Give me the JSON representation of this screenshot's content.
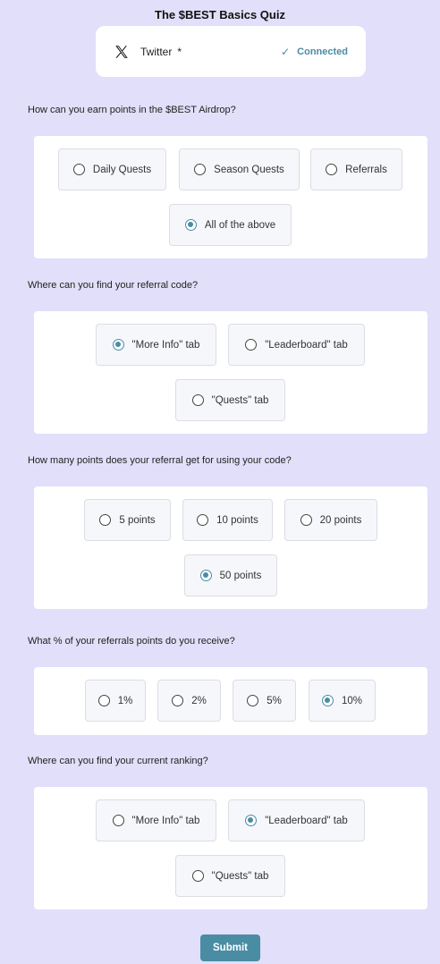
{
  "title": "The $BEST Basics Quiz",
  "twitter": {
    "label": "Twitter",
    "required_mark": "*",
    "status": "Connected",
    "status_icon": "checkmark-icon",
    "logo_icon": "x-logo-icon"
  },
  "accent_color": "#4a8ca3",
  "questions": [
    {
      "text": "How can you earn points in the $BEST Airdrop?",
      "options": [
        "Daily Quests",
        "Season Quests",
        "Referrals",
        "All of the above"
      ],
      "selected": "All of the above"
    },
    {
      "text": "Where can you find your referral code?",
      "options": [
        "\"More Info\" tab",
        "\"Leaderboard\" tab",
        "\"Quests\" tab"
      ],
      "selected": "\"More Info\" tab"
    },
    {
      "text": "How many points does your referral get for using your code?",
      "options": [
        "5 points",
        "10 points",
        "20 points",
        "50 points"
      ],
      "selected": "50 points"
    },
    {
      "text": "What % of your referrals points do you receive?",
      "options": [
        "1%",
        "2%",
        "5%",
        "10%"
      ],
      "selected": "10%"
    },
    {
      "text": "Where can you find your current ranking?",
      "options": [
        "\"More Info\" tab",
        "\"Leaderboard\" tab",
        "\"Quests\" tab"
      ],
      "selected": "\"Leaderboard\" tab"
    }
  ],
  "submit_label": "Submit"
}
